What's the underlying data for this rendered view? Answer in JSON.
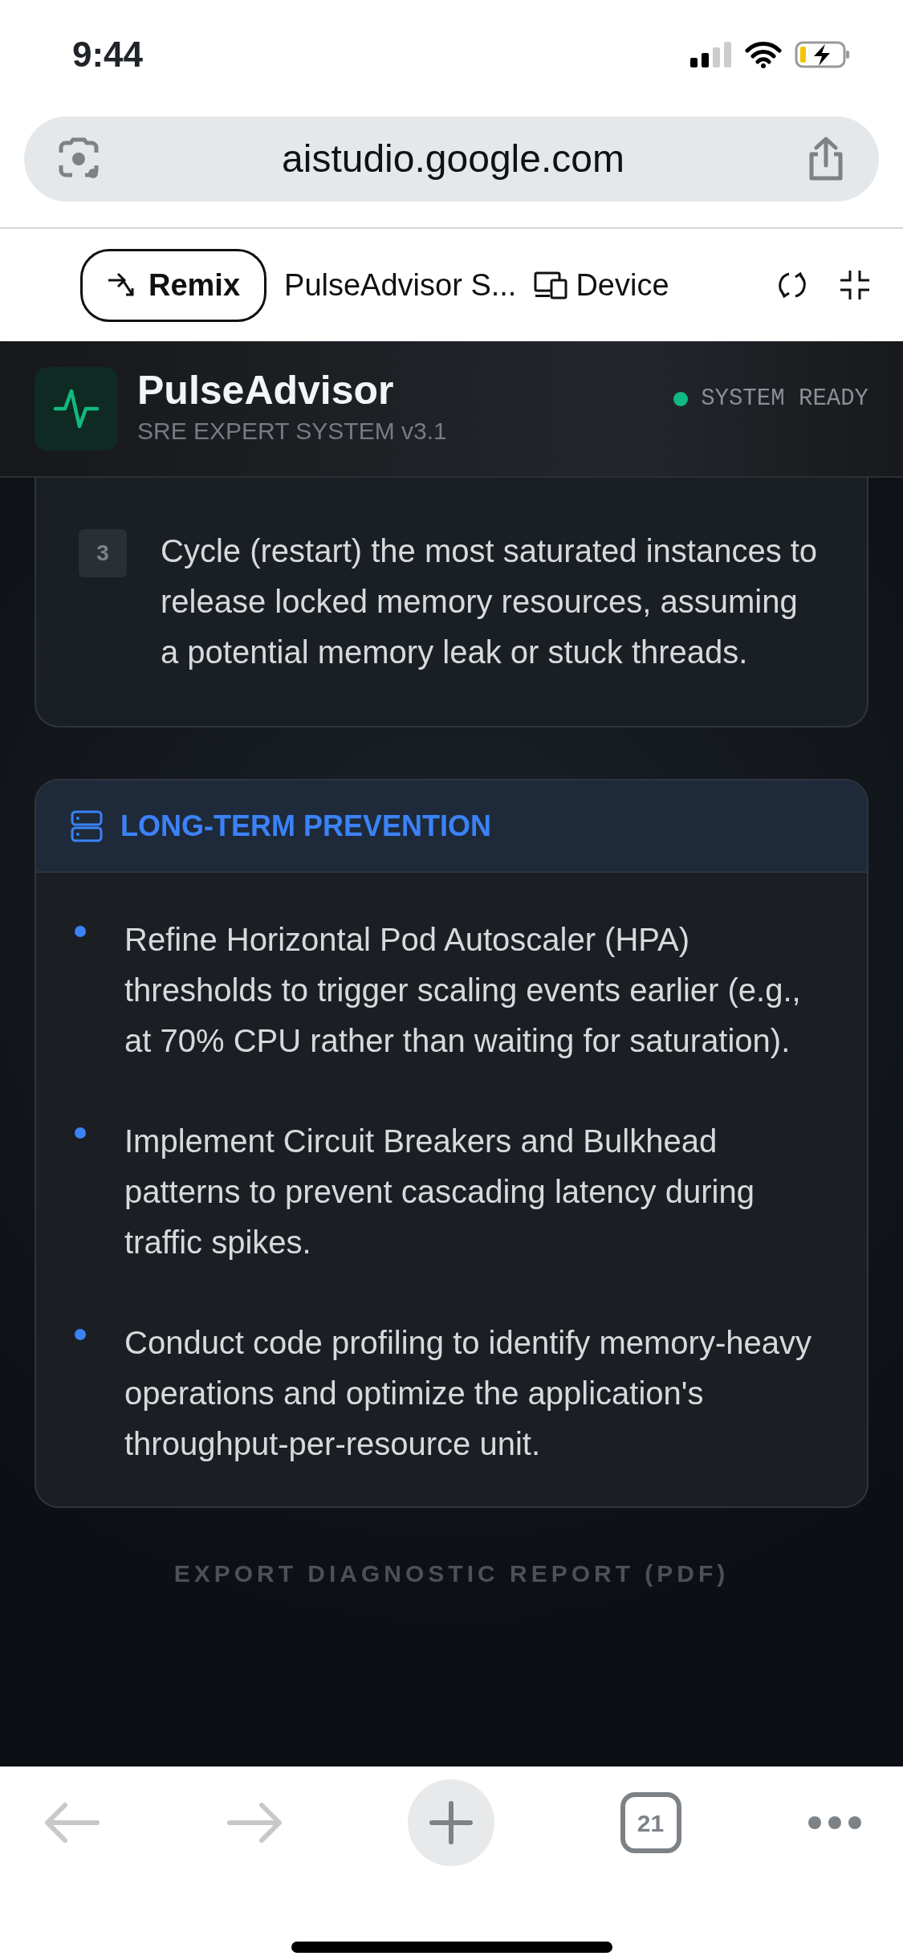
{
  "status_bar": {
    "time": "9:44"
  },
  "browser": {
    "url": "aistudio.google.com"
  },
  "toolbar": {
    "remix_button": "Remix",
    "title": "PulseAdvisor S...",
    "device_button": "Device"
  },
  "app_header": {
    "name": "PulseAdvisor",
    "subtitle": "SRE EXPERT SYSTEM v3.1",
    "status": "SYSTEM READY"
  },
  "steps": [
    {
      "number": "3",
      "text": "Cycle (restart) the most saturated instances to release locked memory resources, assuming a potential memory leak or stuck threads."
    }
  ],
  "prevention": {
    "title": "LONG-TERM PREVENTION",
    "items": [
      {
        "text": "Refine Horizontal Pod Autoscaler (HPA) thresholds to trigger scaling events earlier (e.g., at 70% CPU rather than waiting for saturation)."
      },
      {
        "text": "Implement Circuit Breakers and Bulkhead patterns to prevent cascading latency during traffic spikes."
      },
      {
        "text": "Conduct code profiling to identify memory-heavy operations and optimize the application's throughput-per-resource unit."
      }
    ]
  },
  "export_button": "EXPORT DIAGNOSTIC REPORT (PDF)",
  "bottom_bar": {
    "back": {
      "disabled": true
    },
    "forward": {
      "disabled": true
    },
    "tab_count": "21"
  }
}
